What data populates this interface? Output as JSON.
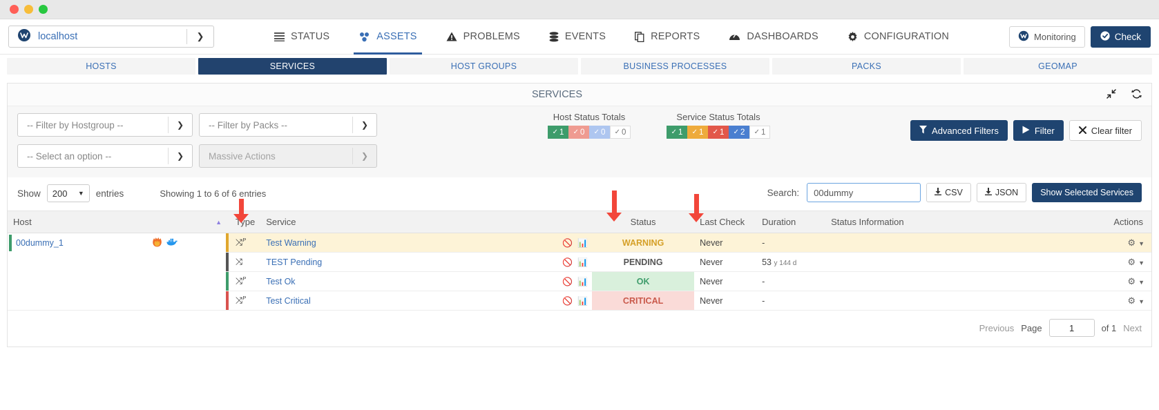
{
  "window": {
    "dots": [
      "close",
      "minimize",
      "maximize"
    ]
  },
  "hostselect": {
    "value": "localhost",
    "icon": "w-logo-icon",
    "caret": "chevron-down-icon"
  },
  "topnav": {
    "items": [
      {
        "label": "STATUS",
        "icon": "list-icon",
        "active": false
      },
      {
        "label": "ASSETS",
        "icon": "assets-icon",
        "active": true
      },
      {
        "label": "PROBLEMS",
        "icon": "warning-triangle-icon",
        "active": false
      },
      {
        "label": "EVENTS",
        "icon": "database-icon",
        "active": false
      },
      {
        "label": "REPORTS",
        "icon": "copy-icon",
        "active": false
      },
      {
        "label": "DASHBOARDS",
        "icon": "dashboard-icon",
        "active": false
      },
      {
        "label": "CONFIGURATION",
        "icon": "gear-icon",
        "active": false
      }
    ],
    "monitoring_label": "Monitoring",
    "check_label": "Check"
  },
  "subtabs": [
    {
      "label": "HOSTS",
      "active": false
    },
    {
      "label": "SERVICES",
      "active": true
    },
    {
      "label": "HOST GROUPS",
      "active": false
    },
    {
      "label": "BUSINESS PROCESSES",
      "active": false
    },
    {
      "label": "PACKS",
      "active": false
    },
    {
      "label": "GEOMAP",
      "active": false
    }
  ],
  "panel": {
    "title": "SERVICES",
    "tools": [
      "collapse-icon",
      "refresh-icon"
    ]
  },
  "filters": {
    "hostgroup_placeholder": "-- Filter by Hostgroup --",
    "packs_placeholder": "-- Filter by Packs --",
    "option_placeholder": "-- Select an option --",
    "massive_actions_placeholder": "Massive Actions",
    "host_totals_caption": "Host Status Totals",
    "service_totals_caption": "Service Status Totals",
    "host_totals": [
      {
        "value": "1",
        "color": "green"
      },
      {
        "value": "0",
        "color": "salmon"
      },
      {
        "value": "0",
        "color": "lblue"
      },
      {
        "value": "0",
        "color": "white"
      }
    ],
    "service_totals": [
      {
        "value": "1",
        "color": "green"
      },
      {
        "value": "1",
        "color": "orange"
      },
      {
        "value": "1",
        "color": "red"
      },
      {
        "value": "2",
        "color": "blue"
      },
      {
        "value": "1",
        "color": "white"
      }
    ],
    "advanced_filters_label": "Advanced Filters",
    "filter_label": "Filter",
    "clear_filter_label": "Clear filter"
  },
  "tablecontrols": {
    "show_label": "Show",
    "page_length": "200",
    "entries_label": "entries",
    "showing_text": "Showing 1 to 6 of 6 entries",
    "search_label": "Search:",
    "search_value": "00dummy",
    "search_placeholder": "",
    "csv_label": "CSV",
    "json_label": "JSON",
    "show_selected_label": "Show Selected Services"
  },
  "table": {
    "columns": [
      "Host",
      "Type",
      "Service",
      "",
      "Status",
      "Last Check",
      "Duration",
      "Status Information",
      "Actions"
    ],
    "host": {
      "name": "00dummy_1",
      "icons": [
        "firefox-icon",
        "docker-icon"
      ]
    },
    "rows": [
      {
        "type_sup": "P",
        "service": "Test Warning",
        "status": "WARNING",
        "status_class": "st-warning",
        "last_check": "Never",
        "duration": "-",
        "duration_sub": "",
        "status_information": "",
        "bar_color": "#e0a72e",
        "highlight": true
      },
      {
        "type_sup": "",
        "service": "TEST Pending",
        "status": "PENDING",
        "status_class": "st-pending",
        "last_check": "Never",
        "duration": "53",
        "duration_sub": "y 144 d",
        "status_information": "",
        "bar_color": "#555555",
        "highlight": false
      },
      {
        "type_sup": "P",
        "service": "Test Ok",
        "status": "OK",
        "status_class": "st-ok",
        "last_check": "Never",
        "duration": "-",
        "duration_sub": "",
        "status_information": "",
        "bar_color": "#3e9c6b",
        "highlight": false
      },
      {
        "type_sup": "P",
        "service": "Test Critical",
        "status": "CRITICAL",
        "status_class": "st-critical",
        "last_check": "Never",
        "duration": "-",
        "duration_sub": "",
        "status_information": "",
        "bar_color": "#d9534f",
        "highlight": false
      }
    ]
  },
  "pagination": {
    "previous": "Previous",
    "page_label": "Page",
    "page_value": "1",
    "of_label": "of 1",
    "next": "Next"
  },
  "annotations": {
    "arrow_color": "#f2463a",
    "count": 3
  }
}
